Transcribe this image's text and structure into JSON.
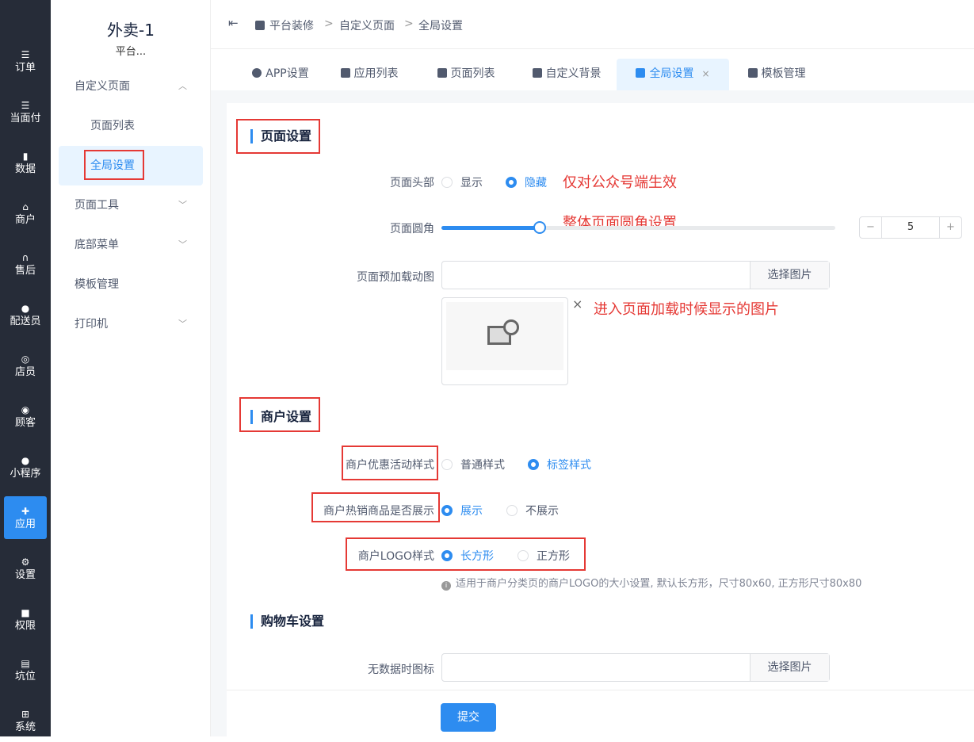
{
  "nav": [
    {
      "icon": "list-icon",
      "label": "订单"
    },
    {
      "icon": "list-icon",
      "label": "当面付"
    },
    {
      "icon": "bar-chart-icon",
      "label": "数据"
    },
    {
      "icon": "store-icon",
      "label": "商户"
    },
    {
      "icon": "headset-icon",
      "label": "售后"
    },
    {
      "icon": "scooter-icon",
      "label": "配送员"
    },
    {
      "icon": "users-icon",
      "label": "店员"
    },
    {
      "icon": "customer-icon",
      "label": "顾客"
    },
    {
      "icon": "wechat-icon",
      "label": "小程序"
    },
    {
      "icon": "apps-icon",
      "label": "应用"
    },
    {
      "icon": "user-settings-icon",
      "label": "设置"
    },
    {
      "icon": "lock-icon",
      "label": "权限"
    },
    {
      "icon": "report-icon",
      "label": "坑位"
    },
    {
      "icon": "windows-icon",
      "label": "系统"
    }
  ],
  "subnav": {
    "title": "外卖-1",
    "subtitle": "平台...",
    "items": [
      "自定义页面",
      "页面列表",
      "全局设置",
      "页面工具",
      "底部菜单",
      "模板管理",
      "打印机"
    ]
  },
  "breadcrumb": [
    "平台装修",
    "自定义页面",
    "全局设置"
  ],
  "tabs": [
    "APP设置",
    "应用列表",
    "页面列表",
    "自定义背景",
    "全局设置",
    "模板管理"
  ],
  "page": {
    "section_page": "页面设置",
    "header_label": "页面头部",
    "header_opt_show": "显示",
    "header_opt_hide": "隐藏",
    "note_header": "仅对公众号端生效",
    "radius_label": "页面圆角",
    "note_radius": "整体页面圆角设置",
    "radius_value": "5",
    "radius_fraction": 0.25,
    "preload_label": "页面预加载动图",
    "choose_image": "选择图片",
    "note_preload": "进入页面加载时候显示的图片",
    "section_merchant": "商户设置",
    "promo_label": "商户优惠活动样式",
    "promo_opt_normal": "普通样式",
    "promo_opt_tag": "标签样式",
    "hot_label": "商户热销商品是否展示",
    "hot_opt_show": "展示",
    "hot_opt_hide": "不展示",
    "logo_label": "商户LOGO样式",
    "logo_opt_rect": "长方形",
    "logo_opt_square": "正方形",
    "logo_hint": "适用于商户分类页的商户LOGO的大小设置, 默认长方形，尺寸80x60, 正方形尺寸80x80",
    "section_cart": "购物车设置",
    "empty_icon_label": "无数据时图标",
    "choose_image_2": "选择图片",
    "submit": "提交"
  },
  "colors": {
    "accent": "#2d8cf0",
    "sidebar": "#262c38",
    "annotation": "#e53935"
  }
}
